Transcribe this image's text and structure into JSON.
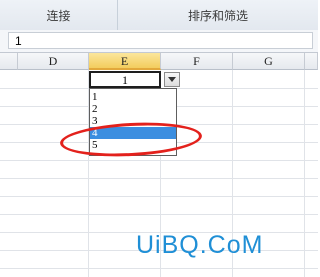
{
  "ribbon": {
    "groups": [
      "连接",
      "排序和筛选"
    ]
  },
  "formula_bar": {
    "value": "1"
  },
  "columns": [
    "D",
    "E",
    "F",
    "G"
  ],
  "selected_column": "E",
  "active_cell": {
    "value": "1"
  },
  "dropdown": {
    "items": [
      "1",
      "2",
      "3",
      "4",
      "5"
    ],
    "highlighted": "4"
  },
  "annotation": {
    "color": "#e3211c"
  },
  "watermark": {
    "text": "UiBQ.CoM"
  }
}
